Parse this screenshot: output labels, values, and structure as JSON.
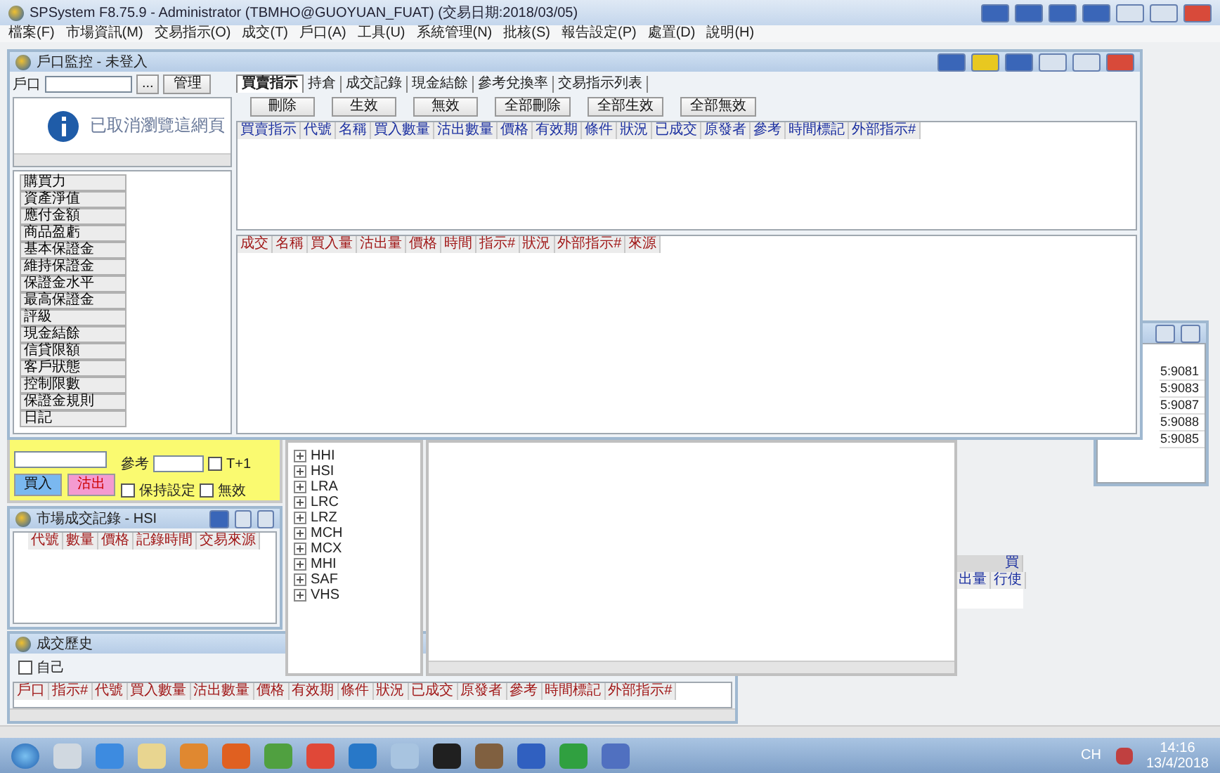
{
  "app_window": {
    "title": "SPSystem F8.75.9 - Administrator (TBMHO@GUOYUAN_FUAT) (交易日期:2018/03/05)",
    "menu": [
      "檔案(F)",
      "市場資訊(M)",
      "交易指示(O)",
      "成交(T)",
      "戶口(A)",
      "工具(U)",
      "系統管理(N)",
      "批核(S)",
      "報告設定(P)",
      "處置(D)",
      "說明(H)"
    ]
  },
  "account_window": {
    "title": "戶口監控 - 未登入",
    "account_label": "戶口",
    "browse_button": "...",
    "manage_button": "管理",
    "info_message": "已取消瀏覽這網頁",
    "side_buttons": [
      "購買力",
      "資產淨值",
      "應付金額",
      "商品盈虧",
      "基本保證金",
      "維持保證金",
      "保證金水平",
      "最高保證金",
      "評級",
      "現金結餘",
      "信貸限額",
      "客戶狀態",
      "控制限數",
      "保證金規則",
      "日記"
    ],
    "tabs": [
      {
        "label": "買賣指示",
        "selected": true
      },
      {
        "label": "持倉",
        "selected": false
      },
      {
        "label": "成交記錄",
        "selected": false
      },
      {
        "label": "現金結餘",
        "selected": false
      },
      {
        "label": "參考兌換率",
        "selected": false
      },
      {
        "label": "交易指示列表",
        "selected": false
      }
    ],
    "action_buttons": [
      "刪除",
      "生效",
      "無效",
      "全部刪除",
      "全部生效",
      "全部無效"
    ],
    "order_columns": [
      "買賣指示",
      "代號",
      "名稱",
      "買入數量",
      "沽出數量",
      "價格",
      "有效期",
      "條件",
      "狀況",
      "已成交",
      "原發者",
      "參考",
      "時間標記",
      "外部指示#"
    ],
    "trade_columns": [
      "成交",
      "名稱",
      "買入量",
      "沽出量",
      "價格",
      "時間",
      "指示#",
      "狀況",
      "外部指示#",
      "來源"
    ]
  },
  "order_entry": {
    "ref_label": "參考",
    "t1_label": "T+1",
    "t1_checked": false,
    "buy_button": "買入",
    "sell_button": "沽出",
    "keep_label": "保持設定",
    "keep_checked": false,
    "invalid_label": "無效",
    "invalid_checked": false
  },
  "product_tree": {
    "items": [
      {
        "label": "HHI",
        "expanded": false
      },
      {
        "label": "HSI",
        "expanded": false
      },
      {
        "label": "LRA",
        "expanded": false
      },
      {
        "label": "LRC",
        "expanded": false
      },
      {
        "label": "LRZ",
        "expanded": false
      },
      {
        "label": "MCH",
        "expanded": false
      },
      {
        "label": "MCX",
        "expanded": false
      },
      {
        "label": "MHI",
        "expanded": false
      },
      {
        "label": "SAF",
        "expanded": false
      },
      {
        "label": "VHS",
        "expanded": false
      }
    ]
  },
  "market_trades": {
    "title": "市場成交記錄 - HSI",
    "columns": [
      "代號",
      "數量",
      "價格",
      "記錄時間",
      "交易來源"
    ]
  },
  "trade_history": {
    "title": "成交歷史",
    "own_label": "自己",
    "own_checked": false,
    "columns": [
      "戶口",
      "指示#",
      "代號",
      "買入數量",
      "沽出數量",
      "價格",
      "有效期",
      "條件",
      "狀況",
      "已成交",
      "原發者",
      "參考",
      "時間標記",
      "外部指示#"
    ]
  },
  "server_list": {
    "rows": [
      "5:9081",
      "5:9083",
      "5:9087",
      "5:9088",
      "5:9085"
    ]
  },
  "partial_table": {
    "header": "買",
    "columns": [
      "出量",
      "行使"
    ]
  },
  "taskbar": {
    "language": "CH",
    "time": "14:16",
    "date": "13/4/2018"
  }
}
